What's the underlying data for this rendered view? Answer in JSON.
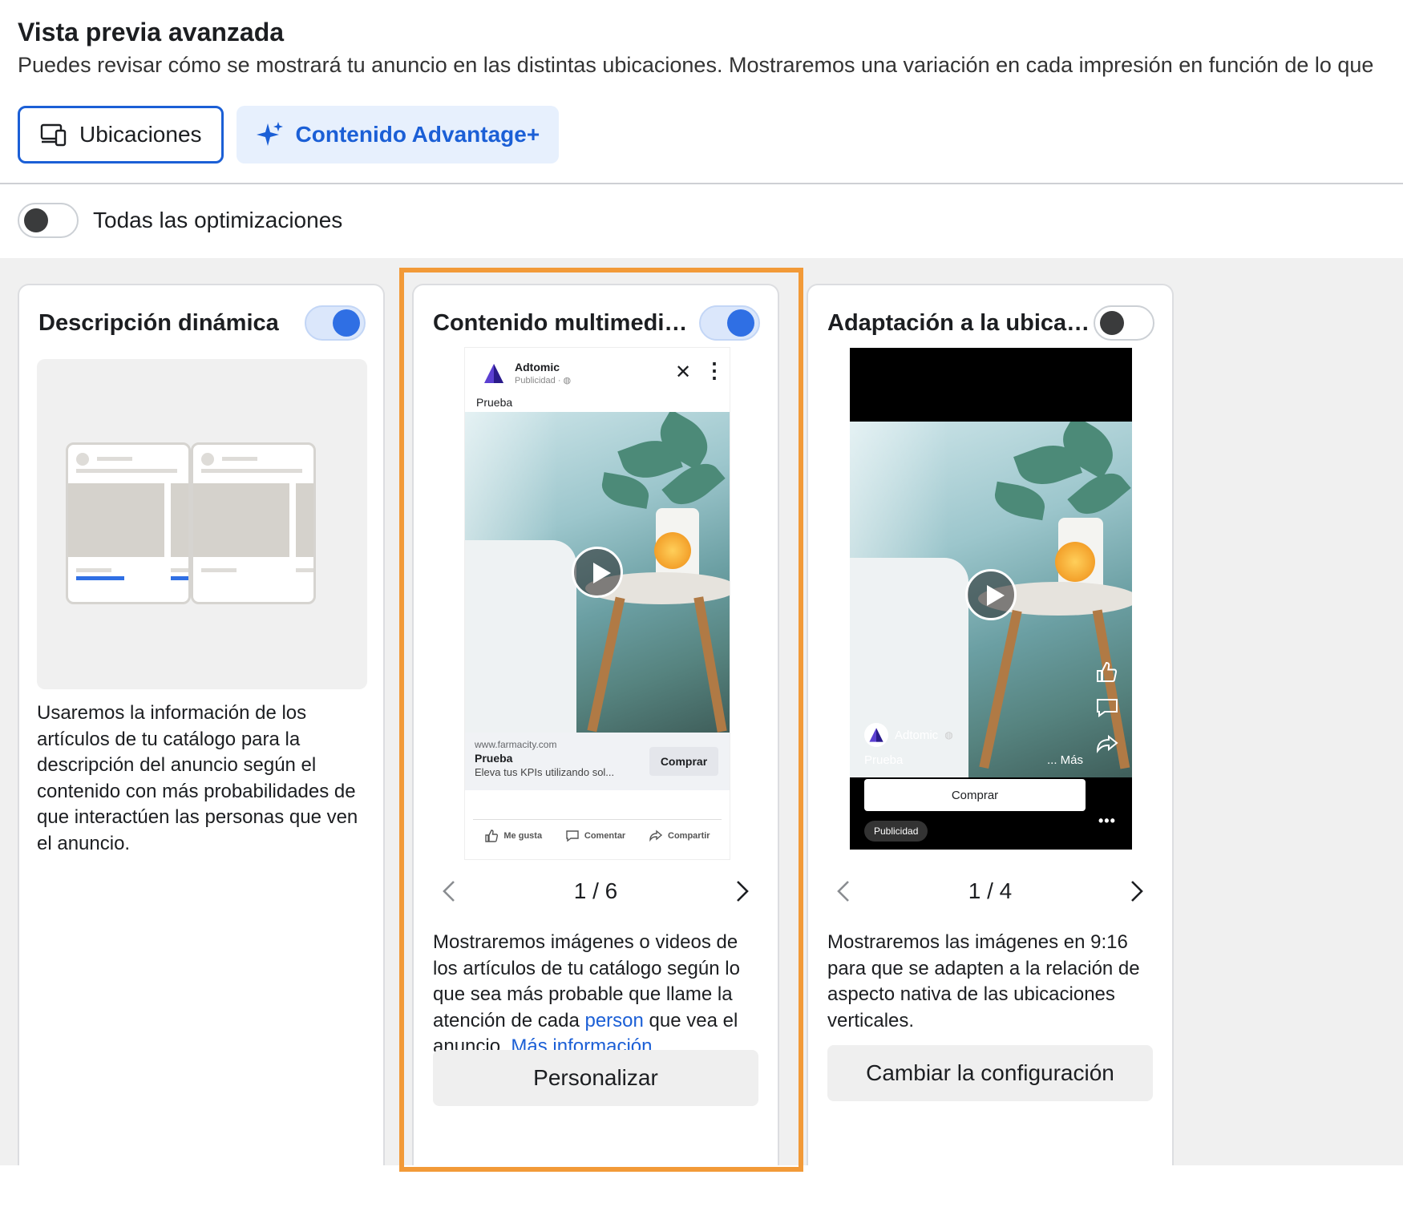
{
  "header": {
    "title": "Vista previa avanzada",
    "subtitle": "Puedes revisar cómo se mostrará tu anuncio en las distintas ubicaciones. Mostraremos una variación en cada impresión en función de lo que"
  },
  "tabs": [
    {
      "label": "Ubicaciones",
      "icon": "devices-icon",
      "selected": true
    },
    {
      "label": "Contenido Advantage+",
      "icon": "sparkle-icon",
      "selected": false
    }
  ],
  "all_optimizations": {
    "label": "Todas las optimizaciones",
    "enabled": false
  },
  "cards": [
    {
      "title": "Descripción dinámica",
      "enabled": true,
      "description": "Usaremos la información de los artículos de tu catálogo para la descripción del anuncio según el contenido con más probabilidades de que interactúen las personas que ven el anuncio."
    },
    {
      "title": "Contenido multimedia di...",
      "enabled": true,
      "preview": {
        "advertiser": "Adtomic",
        "sponsored": "Publicidad · ◍",
        "primary_text": "Prueba",
        "url": "www.farmacity.com",
        "headline": "Prueba",
        "link_description": "Eleva tus KPIs utilizando sol...",
        "cta": "Comprar",
        "actions": {
          "like": "Me gusta",
          "comment": "Comentar",
          "share": "Compartir"
        }
      },
      "pager": "1 / 6",
      "description_parts": {
        "a": "Mostraremos imágenes o videos de los artículos de tu catálogo según lo que sea más probable que llame la atención de cada ",
        "link1": "person",
        "b": " que vea el anuncio. ",
        "link2": "Más información"
      },
      "button": "Personalizar"
    },
    {
      "title": "Adaptación a la ubicación",
      "enabled": false,
      "preview": {
        "advertiser": "Adtomic",
        "primary_text": "Prueba",
        "more": "... Más",
        "cta": "Comprar",
        "badge": "Publicidad",
        "dots": "•••"
      },
      "pager": "1 / 4",
      "description": "Mostraremos las imágenes en 9:16 para que se adapten a la relación de aspecto nativa de las ubicaciones verticales.",
      "button": "Cambiar la configuración"
    }
  ],
  "colors": {
    "accent": "#1b5fd6",
    "highlight": "#f29a38",
    "toggle_on": "#2f6fe4"
  }
}
